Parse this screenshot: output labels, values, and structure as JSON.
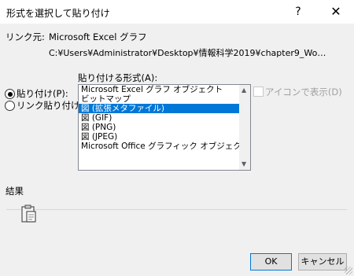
{
  "dialog": {
    "title": "形式を選択して貼り付け",
    "help_glyph": "?",
    "close_glyph": "✕"
  },
  "source": {
    "label": "リンク元:",
    "name": "Microsoft Excel グラフ",
    "path": "C:¥Users¥Administrator¥Desktop¥情報科学2019¥chapter9_Wo…"
  },
  "options": {
    "paste_label": "貼り付け(P):",
    "link_paste_label": "リンク貼り付け(L):",
    "paste_selected": true
  },
  "format_list": {
    "label": "貼り付ける形式(A):",
    "items": [
      "Microsoft Excel グラフ オブジェクト",
      "ビットマップ",
      "図 (拡張メタファイル)",
      "図 (GIF)",
      "図 (PNG)",
      "図 (JPEG)",
      "Microsoft Office グラフィック オブジェクト"
    ],
    "selected_index": 2
  },
  "icon_option": {
    "label": "アイコンで表示(D)",
    "checked": false,
    "enabled": false
  },
  "result": {
    "label": "結果",
    "icon": "clipboard-icon"
  },
  "buttons": {
    "ok": "OK",
    "cancel": "キャンセル"
  }
}
